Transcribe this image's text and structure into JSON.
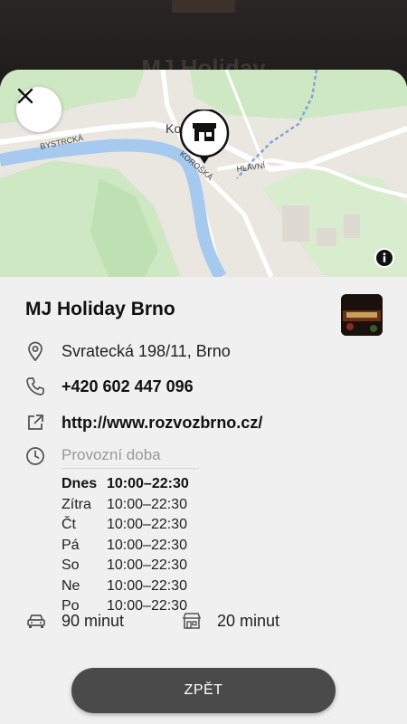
{
  "backdrop": {
    "title": "MJ Holiday"
  },
  "map": {
    "labels": {
      "street1": "BYSTRCKÁ",
      "street2": "KOROŠKÁ",
      "street3": "HLAVNÍ",
      "place": "Ko"
    }
  },
  "place": {
    "name": "MJ Holiday Brno",
    "address": "Svratecká 198/11, Brno",
    "phone": "+420 602 447 096",
    "website": "http://www.rozvozbrno.cz/",
    "hours_label": "Provozní doba",
    "hours": [
      {
        "day": "Dnes",
        "time": "10:00–22:30",
        "today": true
      },
      {
        "day": "Zítra",
        "time": "10:00–22:30"
      },
      {
        "day": "Čt",
        "time": "10:00–22:30"
      },
      {
        "day": "Pá",
        "time": "10:00–22:30"
      },
      {
        "day": "So",
        "time": "10:00–22:30"
      },
      {
        "day": "Ne",
        "time": "10:00–22:30"
      },
      {
        "day": "Po",
        "time": "10:00–22:30"
      }
    ],
    "delivery_time": "90 minut",
    "pickup_time": "20 minut"
  },
  "buttons": {
    "back": "ZPĚT"
  },
  "icons": {
    "close": "close-icon",
    "info": "info-icon",
    "pin": "store-pin-icon",
    "address": "location-pin-icon",
    "phone": "phone-icon",
    "website": "external-link-icon",
    "hours": "clock-icon",
    "delivery": "car-icon",
    "pickup": "store-icon"
  },
  "colors": {
    "sheet": "#f0f0f0",
    "button": "#4a4a4a",
    "river": "#a6c9ef",
    "park": "#cde8c2"
  }
}
